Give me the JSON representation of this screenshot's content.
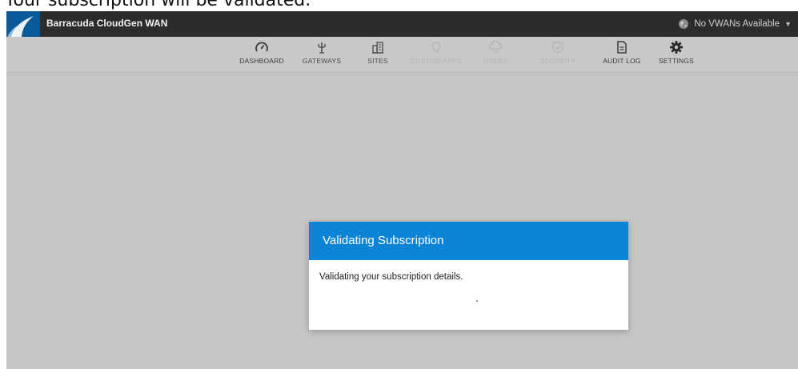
{
  "caption": "Your subscription will be validated.",
  "app": {
    "title": "Barracuda CloudGen WAN",
    "vwan_selector": "No VWANs Available"
  },
  "nav": [
    {
      "label": "DASHBOARD",
      "icon": "gauge-icon",
      "enabled": true
    },
    {
      "label": "GATEWAYS",
      "icon": "antenna-icon",
      "enabled": true
    },
    {
      "label": "SITES",
      "icon": "building-icon",
      "enabled": true
    },
    {
      "label": "CUSTOM APPS",
      "icon": "lightbulb-icon",
      "enabled": false
    },
    {
      "label": "USERS",
      "icon": "cloud-users-icon",
      "enabled": false
    },
    {
      "label": "SECURITY",
      "icon": "shield-icon",
      "enabled": false
    },
    {
      "label": "AUDIT LOG",
      "icon": "document-icon",
      "enabled": true
    },
    {
      "label": "SETTINGS",
      "icon": "gear-icon",
      "enabled": true
    }
  ],
  "modal": {
    "title": "Validating Subscription",
    "message": "Validating your subscription details."
  },
  "colors": {
    "topbar": "#2c2c2c",
    "overlay": "#c6c6c6",
    "modal_header": "#0b84d6",
    "logo": "#0a5a9a"
  }
}
